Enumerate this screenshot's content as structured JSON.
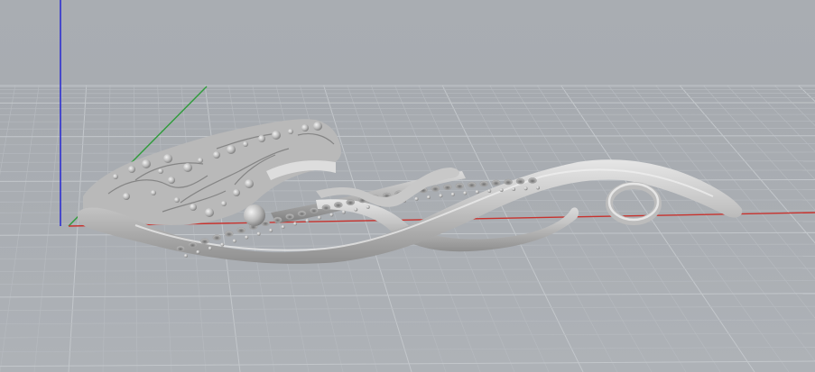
{
  "viewport": {
    "view": "perspective",
    "background_color": "#a7abb0",
    "grid_minor_color": "#b6babf",
    "grid_major_color": "#c3c7cb",
    "axis_colors": {
      "x": "#c8322d",
      "y": "#2e9c3a",
      "z": "#2d2fd0"
    },
    "model": {
      "type": "3d-mesh-jewelry-pendant",
      "material_color": "#c9c9c9",
      "shading": "smooth-gray"
    }
  }
}
